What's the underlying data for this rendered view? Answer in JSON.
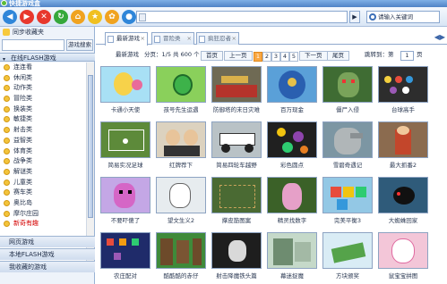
{
  "app": {
    "title": "快捷游戏盒"
  },
  "toolbar": {
    "buttons": [
      {
        "name": "back-icon",
        "color": "#2f86d9",
        "glyph": "◀"
      },
      {
        "name": "forward-icon",
        "color": "#e8382d",
        "glyph": "▶"
      },
      {
        "name": "stop-icon",
        "color": "#e8382d",
        "glyph": "✕"
      },
      {
        "name": "refresh-icon",
        "color": "#35a83b",
        "glyph": "↻"
      },
      {
        "name": "home-icon",
        "color": "#f0a320",
        "glyph": "⌂"
      },
      {
        "name": "favorite-icon",
        "color": "#f0c020",
        "glyph": "★"
      },
      {
        "name": "settings-icon",
        "color": "#f0a320",
        "glyph": "✿"
      },
      {
        "name": "history-icon",
        "color": "#2f86d9",
        "glyph": "●"
      },
      {
        "name": "mail-icon",
        "color": "#4a90d9",
        "glyph": "✉"
      }
    ],
    "address_value": "",
    "go_label": "▶",
    "search_placeholder": "请输入关键词"
  },
  "sidebar": {
    "favorites_label": "同步收藏夹",
    "search_button": "游戏搜索",
    "online_header": "在线FLASH游戏",
    "categories": [
      "连连看",
      "休闲类",
      "动作类",
      "冒险类",
      "换装类",
      "敏捷类",
      "射击类",
      "益智类",
      "体育类",
      "战争类",
      "解谜类",
      "儿童类",
      "赛车类",
      "奥比岛",
      "摩尔庄园",
      "新奇有趣"
    ],
    "selected_index": 15,
    "web_games": "网页游戏",
    "local_flash": "本地FLASH游戏",
    "my_favorites": "我收藏的游戏"
  },
  "tabs": [
    {
      "label": "最新游戏",
      "active": true
    },
    {
      "label": "冒险类",
      "active": false
    },
    {
      "label": "疯狂忍者",
      "active": false
    }
  ],
  "pager": {
    "title": "最新游戏",
    "summary": "分页：1/5 共 600 个",
    "first": "首页",
    "prev": "上一页",
    "pages": [
      "1",
      "2",
      "3",
      "4",
      "5"
    ],
    "current": "1",
    "next": "下一页",
    "last": "尾页",
    "jump_label": "跳转到：第",
    "jump_value": "1",
    "jump_suffix": "页"
  },
  "games": [
    "卡通小天使",
    "孩号先生运遇",
    "防御塔的末日灾难",
    "百万现金",
    "僵尸入侵",
    "台球高手",
    "简易实况足球",
    "红牌荐下",
    "简易四轮车越野",
    "彩色圆点",
    "雪碧奇遇记",
    "最大抓番2",
    "不要吓傻了",
    "望文生义2",
    "撑皮筋图案",
    "精灵找数字",
    "完美平衡3",
    "大蜘蛛回家",
    "农庄配对",
    "酷酷酷的赤仔",
    "射击降魔铁头篇",
    "幕迷捉魔",
    "方块颁奖",
    "鼠宝宝拼图"
  ]
}
